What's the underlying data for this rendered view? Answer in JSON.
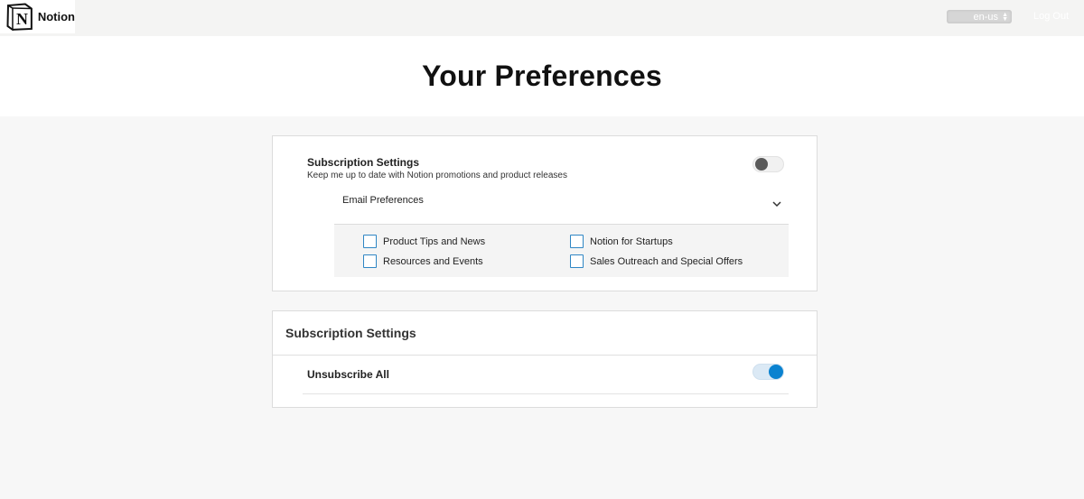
{
  "header": {
    "brand": "Notion",
    "logo_letter": "N",
    "language": "en-us",
    "logout_label": "Log Out"
  },
  "hero": {
    "title": "Your Preferences"
  },
  "subscription_card": {
    "title": "Subscription Settings",
    "description": "Keep me up to date with Notion promotions and product releases",
    "toggle_on": false,
    "email_preferences_label": "Email Preferences",
    "options": [
      {
        "label": "Product Tips and News",
        "checked": false
      },
      {
        "label": "Notion for Startups",
        "checked": false
      },
      {
        "label": "Resources and Events",
        "checked": false
      },
      {
        "label": "Sales Outreach and Special Offers",
        "checked": false
      }
    ]
  },
  "unsubscribe_card": {
    "title": "Subscription Settings",
    "unsubscribe_label": "Unsubscribe All",
    "toggle_on": true
  },
  "colors": {
    "accent": "#0a82d0",
    "checkbox_border": "#2f86c4",
    "page_bg": "#f7f7f7"
  }
}
